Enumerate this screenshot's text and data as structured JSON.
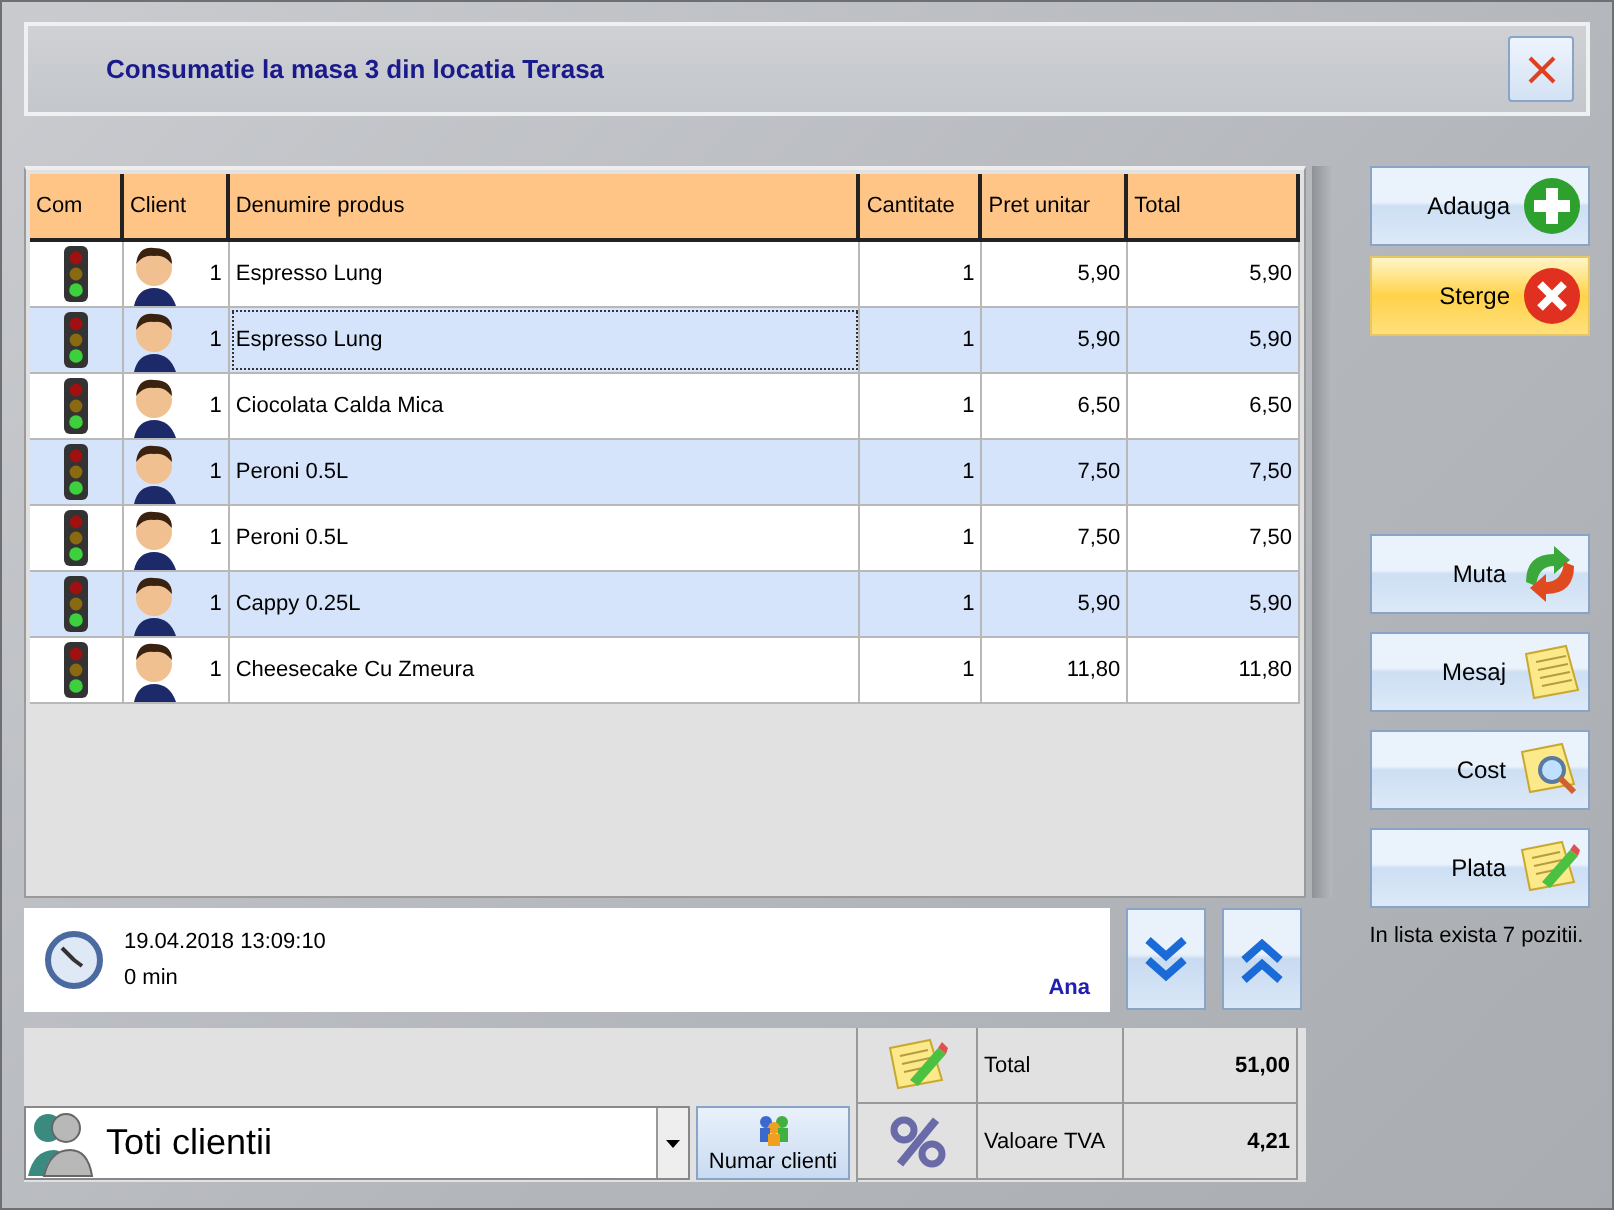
{
  "window": {
    "title": "Consumatie la masa 3 din locatia Terasa"
  },
  "table": {
    "columns": [
      "Com",
      "Client",
      "Denumire produs",
      "Cantitate",
      "Pret unitar",
      "Total"
    ],
    "rows": [
      {
        "client": "1",
        "product": "Espresso Lung",
        "quantity": "1",
        "unit_price": "5,90",
        "total": "5,90",
        "selected": false
      },
      {
        "client": "1",
        "product": "Espresso Lung",
        "quantity": "1",
        "unit_price": "5,90",
        "total": "5,90",
        "selected": true
      },
      {
        "client": "1",
        "product": "Ciocolata Calda Mica",
        "quantity": "1",
        "unit_price": "6,50",
        "total": "6,50",
        "selected": false
      },
      {
        "client": "1",
        "product": "Peroni 0.5L",
        "quantity": "1",
        "unit_price": "7,50",
        "total": "7,50",
        "selected": false
      },
      {
        "client": "1",
        "product": "Peroni 0.5L",
        "quantity": "1",
        "unit_price": "7,50",
        "total": "7,50",
        "selected": false
      },
      {
        "client": "1",
        "product": "Cappy 0.25L",
        "quantity": "1",
        "unit_price": "5,90",
        "total": "5,90",
        "selected": false
      },
      {
        "client": "1",
        "product": "Cheesecake Cu Zmeura",
        "quantity": "1",
        "unit_price": "11,80",
        "total": "11,80",
        "selected": false
      }
    ]
  },
  "info": {
    "datetime": "19.04.2018 13:09:10",
    "duration": "0 min",
    "waiter": "Ana"
  },
  "actions": [
    {
      "label": "Adauga",
      "kind": "add",
      "highlighted": false
    },
    {
      "label": "Sterge",
      "kind": "delete",
      "highlighted": true
    },
    {
      "label": "Muta",
      "kind": "move",
      "highlighted": false
    },
    {
      "label": "Mesaj",
      "kind": "message",
      "highlighted": false
    },
    {
      "label": "Cost",
      "kind": "cost",
      "highlighted": false
    },
    {
      "label": "Plata",
      "kind": "pay",
      "highlighted": false
    }
  ],
  "position_count": "In lista exista 7 pozitii.",
  "client_filter": {
    "value": "Toti clientii"
  },
  "client_count_button": "Numar clienti",
  "summary": [
    {
      "kind": "total",
      "label": "Total",
      "value": "51,00"
    },
    {
      "kind": "vat",
      "label": "Valoare TVA",
      "value": "4,21"
    }
  ]
}
